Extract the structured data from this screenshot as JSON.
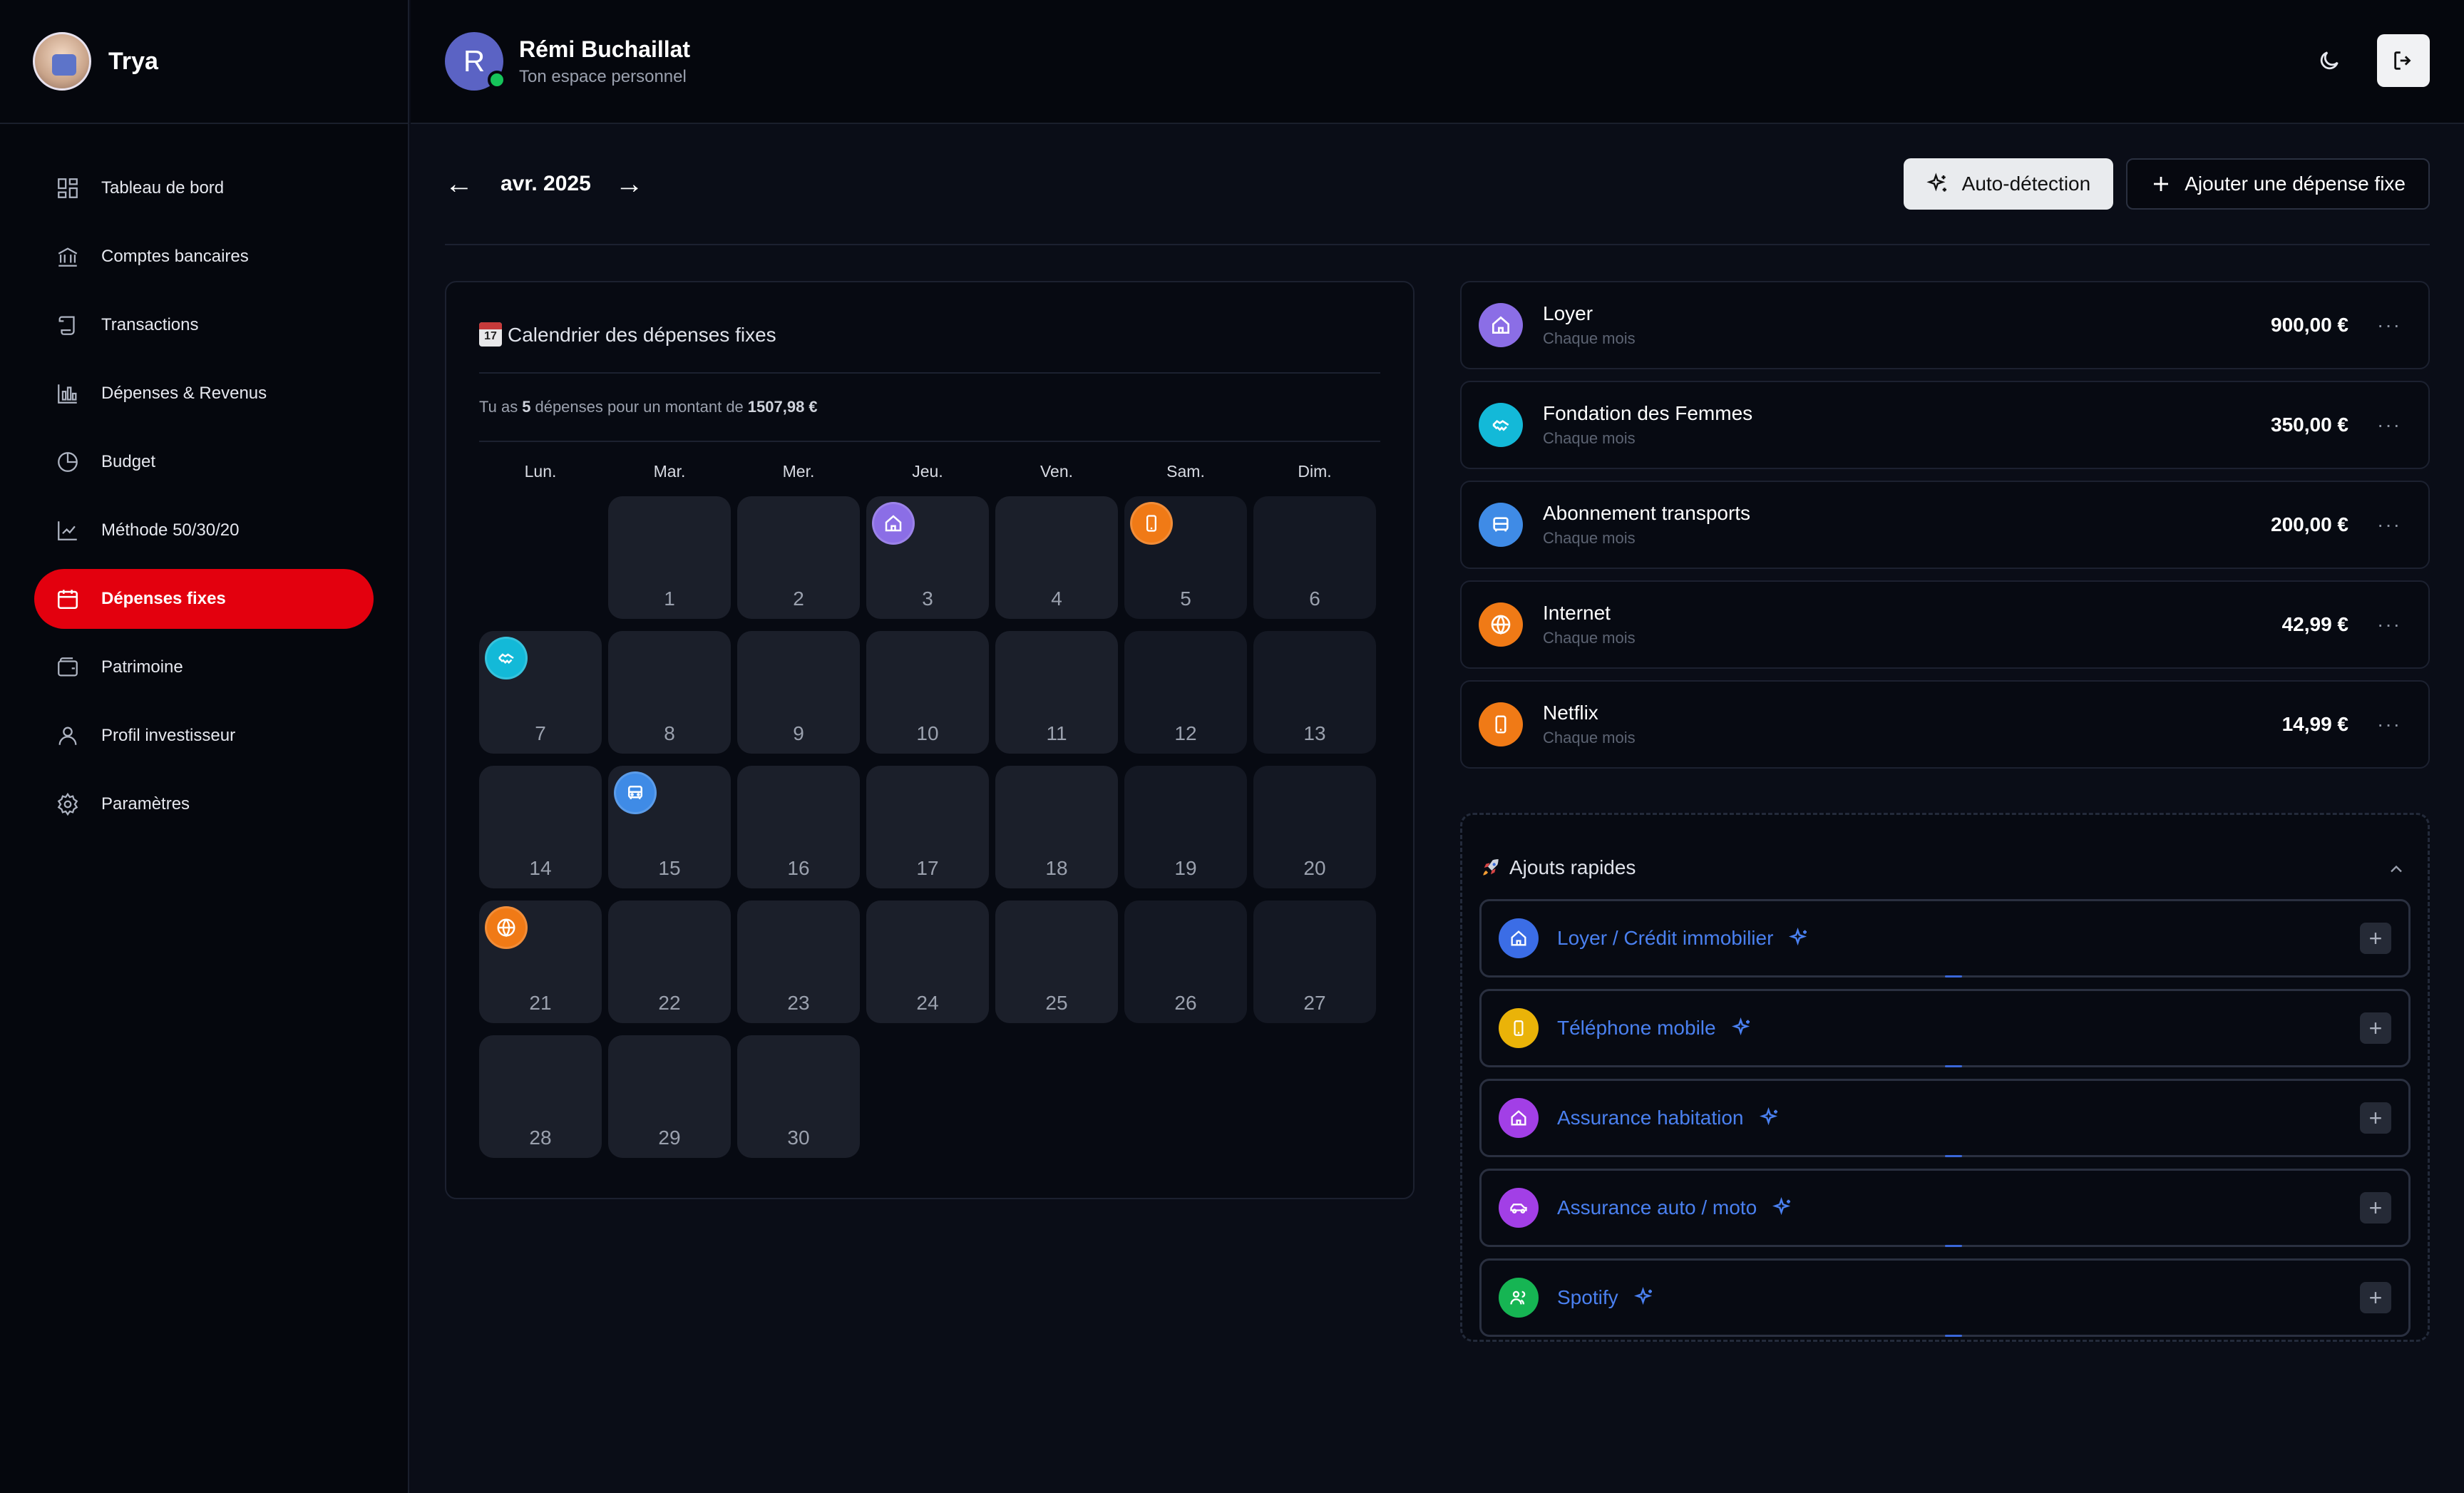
{
  "brand": {
    "name": "Trya"
  },
  "nav": [
    {
      "label": "Tableau de bord",
      "icon": "dashboard-icon"
    },
    {
      "label": "Comptes bancaires",
      "icon": "bank-icon"
    },
    {
      "label": "Transactions",
      "icon": "scroll-icon"
    },
    {
      "label": "Dépenses & Revenus",
      "icon": "bar-chart-icon"
    },
    {
      "label": "Budget",
      "icon": "pie-chart-icon"
    },
    {
      "label": "Méthode 50/30/20",
      "icon": "line-chart-icon"
    },
    {
      "label": "Dépenses fixes",
      "icon": "calendar-icon",
      "active": true
    },
    {
      "label": "Patrimoine",
      "icon": "wallet-icon"
    },
    {
      "label": "Profil investisseur",
      "icon": "user-icon"
    },
    {
      "label": "Paramètres",
      "icon": "gear-icon"
    }
  ],
  "user": {
    "initial": "R",
    "name": "Rémi Buchaillat",
    "subtitle": "Ton espace personnel"
  },
  "month": {
    "label": "avr. 2025",
    "prev": "←",
    "next": "→"
  },
  "actions": {
    "auto_detect": "Auto-détection",
    "add_fixed": "Ajouter une dépense fixe"
  },
  "calendar": {
    "title": "Calendrier des dépenses fixes",
    "summary_prefix": "Tu as",
    "summary_count": "5",
    "summary_mid": "dépenses pour un montant de",
    "summary_total": "1507,98 €",
    "weekdays": [
      "Lun.",
      "Mar.",
      "Mer.",
      "Jeu.",
      "Ven.",
      "Sam.",
      "Dim."
    ],
    "days": [
      "1",
      "2",
      "3",
      "4",
      "5",
      "6",
      "7",
      "8",
      "9",
      "10",
      "11",
      "12",
      "13",
      "14",
      "15",
      "16",
      "17",
      "18",
      "19",
      "20",
      "21",
      "22",
      "23",
      "24",
      "25",
      "26",
      "27",
      "28",
      "29",
      "30"
    ]
  },
  "expenses": [
    {
      "name": "Loyer",
      "frequency": "Chaque mois",
      "amount": "900,00 €",
      "color": "#8b6ee6",
      "icon": "home-icon"
    },
    {
      "name": "Fondation des Femmes",
      "frequency": "Chaque mois",
      "amount": "350,00 €",
      "color": "#13b9d8",
      "icon": "handshake-icon"
    },
    {
      "name": "Abonnement transports",
      "frequency": "Chaque mois",
      "amount": "200,00 €",
      "color": "#3f8be6",
      "icon": "bus-icon"
    },
    {
      "name": "Internet",
      "frequency": "Chaque mois",
      "amount": "42,99 €",
      "color": "#f07a16",
      "icon": "globe-icon"
    },
    {
      "name": "Netflix",
      "frequency": "Chaque mois",
      "amount": "14,99 €",
      "color": "#f07a16",
      "icon": "phone-icon"
    }
  ],
  "quick": {
    "title": "Ajouts rapides",
    "items": [
      {
        "label": "Loyer / Crédit immobilier",
        "color": "#3b6de6",
        "icon": "home-icon"
      },
      {
        "label": "Téléphone mobile",
        "color": "#eab308",
        "icon": "phone-icon"
      },
      {
        "label": "Assurance habitation",
        "color": "#a23fe6",
        "icon": "home-icon"
      },
      {
        "label": "Assurance auto / moto",
        "color": "#a23fe6",
        "icon": "car-icon"
      },
      {
        "label": "Spotify",
        "color": "#16b553",
        "icon": "users-icon"
      }
    ]
  }
}
